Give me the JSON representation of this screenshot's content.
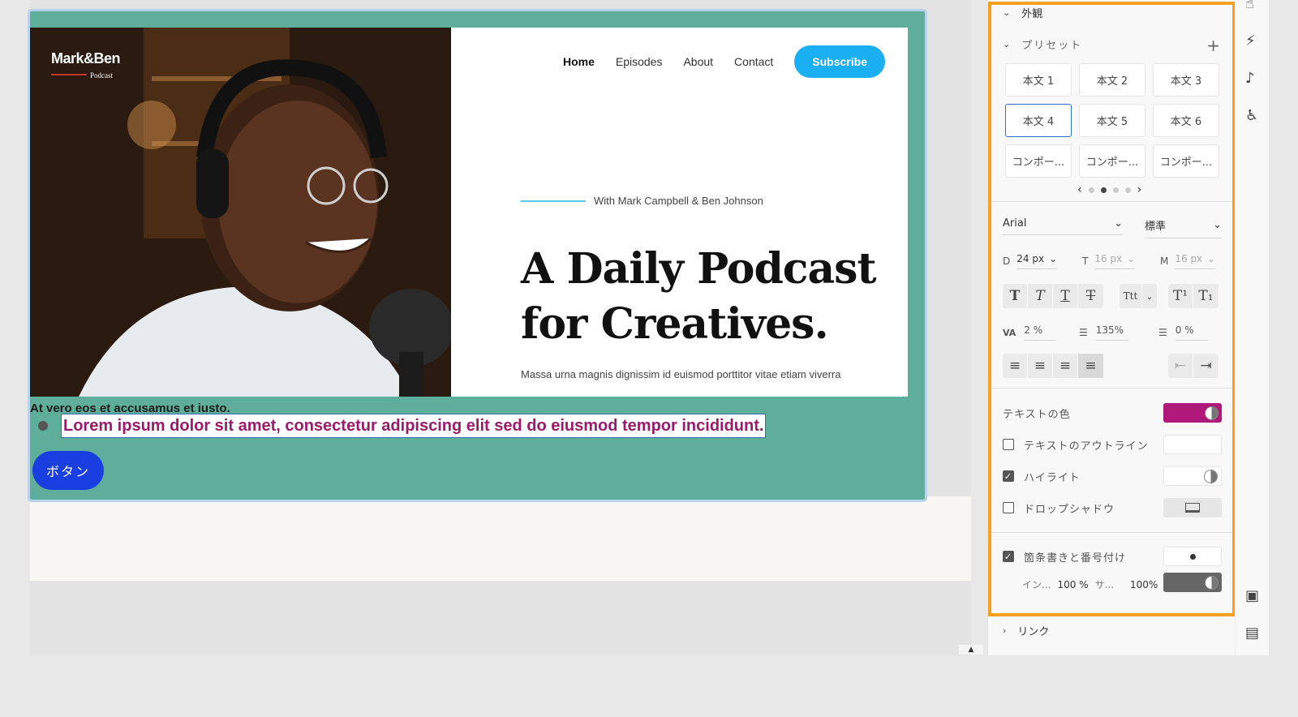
{
  "site": {
    "logo_name": "Mark&Ben",
    "logo_sub": "Podcast",
    "nav": [
      "Home",
      "Episodes",
      "About",
      "Contact"
    ],
    "subscribe_label": "Subscribe",
    "tagline": "With Mark Campbell & Ben Johnson",
    "headline_line1": "A Daily Podcast",
    "headline_line2": "for Creatives.",
    "body": "Massa urna magnis dignissim id euismod porttitor vitae etiam viverra",
    "below_text": "At vero eos et accusamus et iusto.",
    "selected_text": "Lorem ipsum dolor sit amet, consectetur adipiscing elit sed do eiusmod tempor incididunt.",
    "button_label": "ボタン"
  },
  "panel": {
    "appearance_label": "外観",
    "presets_label": "プリセット",
    "presets": [
      "本文 1",
      "本文 2",
      "本文 3",
      "本文 4",
      "本文 5",
      "本文 6",
      "コンポー...",
      "コンポー...",
      "コンポー..."
    ],
    "active_preset": "本文 4",
    "pager_pages": 4,
    "pager_current": 2,
    "font_family": "Arial",
    "font_weight": "標準",
    "size_d_label": "D",
    "size_d": "24 px",
    "size_t_label": "T",
    "size_t": "16 px",
    "size_m_label": "M",
    "size_m": "16 px",
    "style_buttons": [
      "T",
      "T",
      "T",
      "T"
    ],
    "case_button": "Ttt",
    "script_buttons": [
      "T¹",
      "T₁"
    ],
    "letter_spacing": "2 %",
    "line_height": "135%",
    "paragraph_spacing": "0 %",
    "text_color_label": "テキストの色",
    "text_color": "#b0187a",
    "outline_label": "テキストのアウトライン",
    "highlight_label": "ハイライト",
    "shadow_label": "ドロップシャドウ",
    "bullets_label": "箇条書きと番号付け",
    "inset_label": "イン...",
    "inset_value": "100 %",
    "size_label": "サ...",
    "size_value": "100%",
    "bullet_color": "#666666",
    "link_label": "リンク"
  },
  "colors": {
    "section_bg": "#5fae9b",
    "accent_blue": "#1aaef3",
    "button_blue": "#1a3fe0",
    "panel_highlight": "#f5a020"
  }
}
